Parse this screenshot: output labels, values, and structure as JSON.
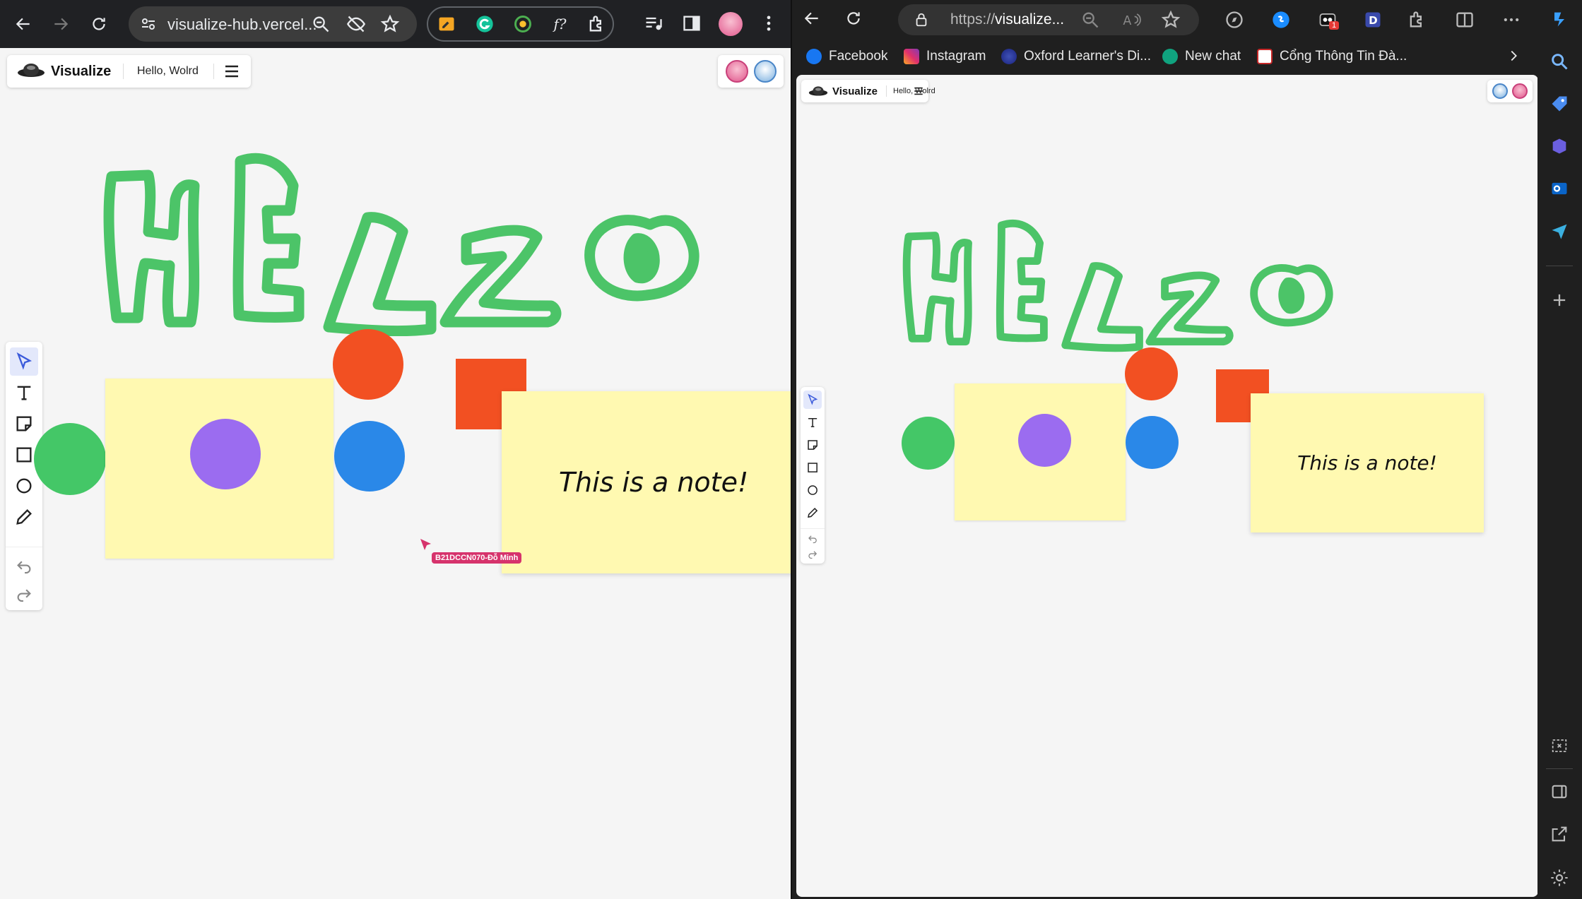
{
  "left_browser": {
    "url": "visualize-hub.vercel...",
    "app": {
      "logo_text": "Visualize",
      "board_name": "Hello, Wolrd",
      "note_text": "This is a note!",
      "cursor_label": "B21DCCN070-Đỗ Minh",
      "drawing_text": "HELLO"
    }
  },
  "right_browser": {
    "url_prefix": "https://",
    "url_host": "visualize...",
    "bookmarks": [
      "Facebook",
      "Instagram",
      "Oxford Learner's Di...",
      "New chat",
      "Cổng Thông Tin Đà..."
    ],
    "notification_badge": "1",
    "app": {
      "logo_text": "Visualize",
      "board_name": "Hello, Wolrd",
      "note_text": "This is a note!",
      "drawing_text": "HELLO"
    }
  },
  "colors": {
    "green": "#44c767",
    "purple": "#9b6cf0",
    "orange": "#f25022",
    "blue": "#2a88e8",
    "note": "#fff9b1",
    "cursor": "#d6336c"
  },
  "icons": [
    "back-icon",
    "forward-icon",
    "reload-icon",
    "zoom-icon",
    "eye-off-icon",
    "star-icon",
    "extensions-icon",
    "menu-icon",
    "select-icon",
    "text-icon",
    "note-icon",
    "rectangle-icon",
    "ellipse-icon",
    "pencil-icon",
    "undo-icon",
    "redo-icon"
  ]
}
